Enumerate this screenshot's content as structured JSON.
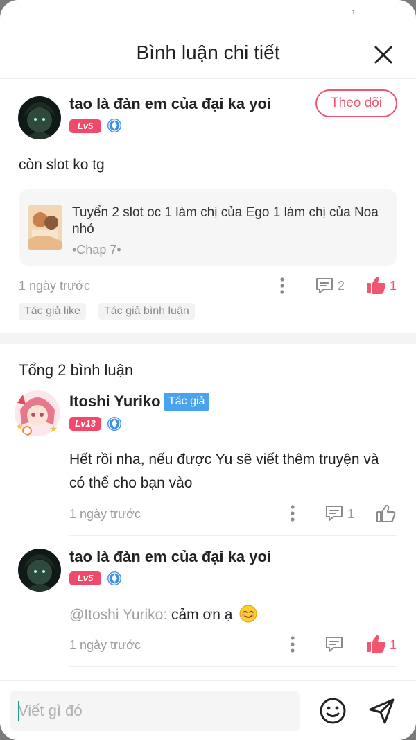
{
  "header": {
    "title": "Bình luận chi tiết"
  },
  "main_comment": {
    "username": "tao là đàn em của đại ka yoi",
    "level": "Lv5",
    "follow_label": "Theo dõi",
    "text": "còn slot ko tg",
    "chapter": {
      "title": "Tuyển 2 slot oc 1 làm chị của Ego 1 làm chị của Noa nhó",
      "sub": "•Chap 7•"
    },
    "time": "1 ngày trước",
    "reply_count": "2",
    "like_count": "1",
    "tags": [
      "Tác giả like",
      "Tác giả bình luận"
    ]
  },
  "replies_header": "Tổng 2 bình luận",
  "replies": [
    {
      "username": "Itoshi Yuriko",
      "author_tag": "Tác giả",
      "level": "Lv13",
      "text": "Hết rồi nha, nếu được Yu sẽ viết thêm truyện và có thể cho bạn vào",
      "time": "1 ngày trước",
      "reply_count": "1"
    },
    {
      "username": "tao là đàn em của đại ka yoi",
      "level": "Lv5",
      "mention": "@Itoshi Yuriko:",
      "text": " cảm ơn ạ",
      "time": "1 ngày trước",
      "like_count": "1"
    }
  ],
  "composer": {
    "placeholder": "Viết gì đó"
  },
  "colors": {
    "accent": "#f0566f",
    "author_tag": "#4aa3f0",
    "level_badge": "#f2486a"
  }
}
